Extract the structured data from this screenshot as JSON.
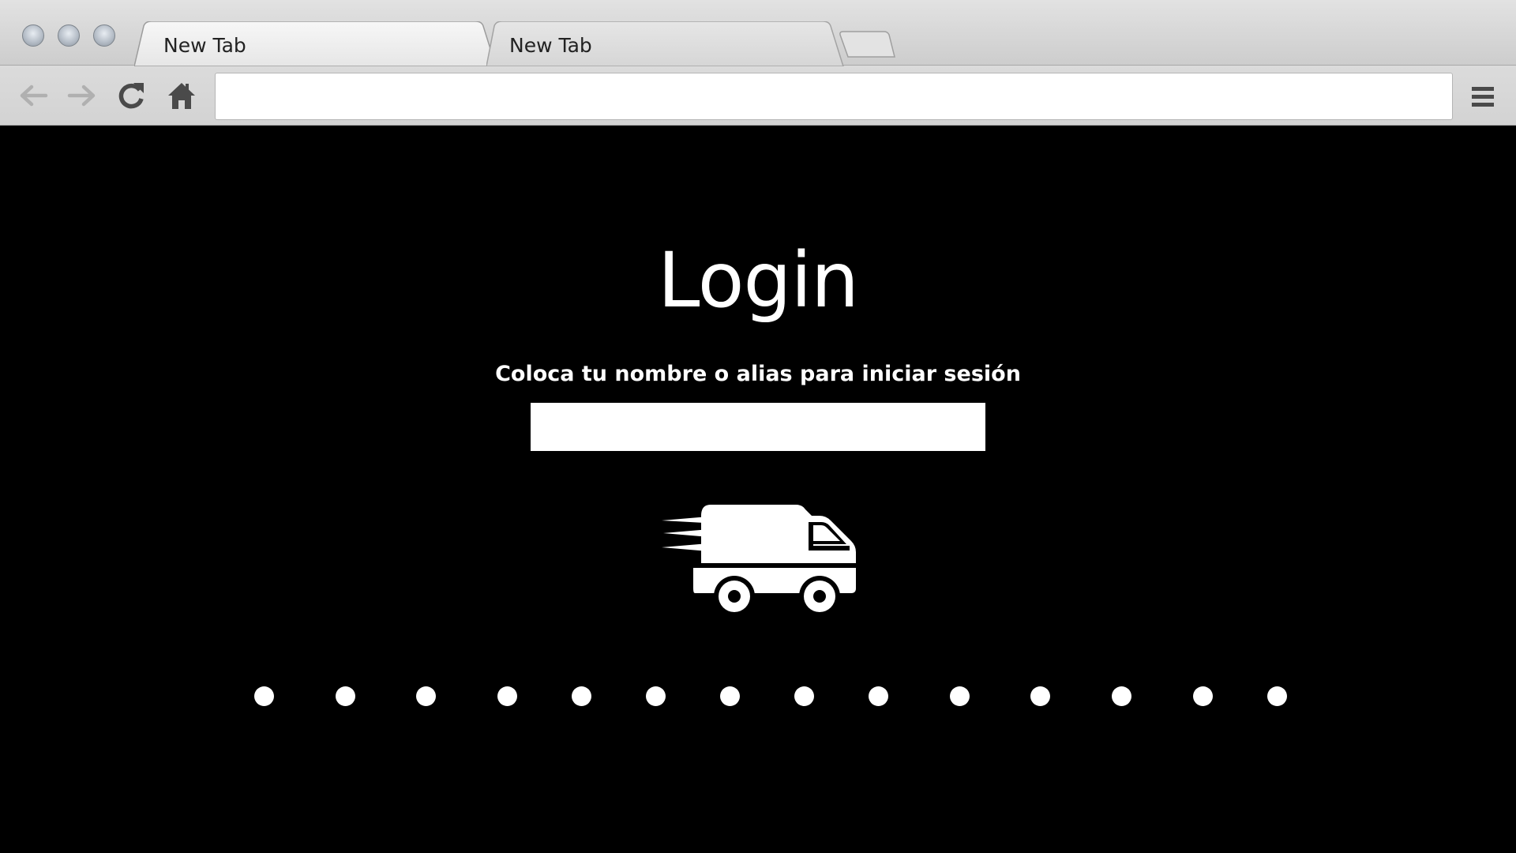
{
  "browser": {
    "tabs": [
      {
        "label": "New Tab",
        "active": true
      },
      {
        "label": "New Tab",
        "active": false
      }
    ],
    "address_bar": {
      "value": "",
      "placeholder": ""
    },
    "icons": {
      "back": "arrow-left-icon",
      "forward": "arrow-right-icon",
      "reload": "reload-icon",
      "home": "home-icon",
      "menu": "hamburger-menu-icon"
    }
  },
  "login": {
    "title": "Login",
    "subtitle": "Coloca tu nombre o alias para iniciar sesión",
    "name_input": {
      "value": "",
      "placeholder": ""
    },
    "icon": "delivery-truck-icon",
    "dots_count": 14
  },
  "colors": {
    "page_background": "#000000",
    "foreground": "#ffffff"
  }
}
